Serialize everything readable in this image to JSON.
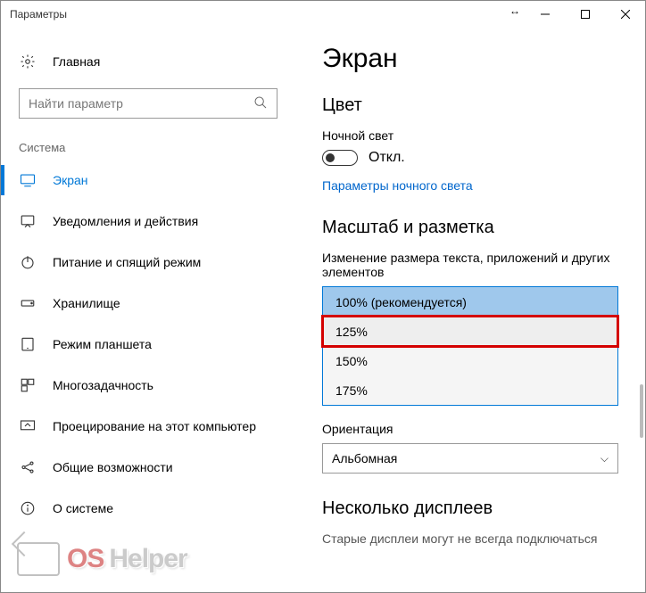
{
  "window": {
    "title": "Параметры"
  },
  "sidebar": {
    "home": "Главная",
    "search_placeholder": "Найти параметр",
    "section": "Система",
    "items": [
      {
        "label": "Экран"
      },
      {
        "label": "Уведомления и действия"
      },
      {
        "label": "Питание и спящий режим"
      },
      {
        "label": "Хранилище"
      },
      {
        "label": "Режим планшета"
      },
      {
        "label": "Многозадачность"
      },
      {
        "label": "Проецирование на этот компьютер"
      },
      {
        "label": "Общие возможности"
      },
      {
        "label": "О системе"
      }
    ]
  },
  "main": {
    "page_title": "Экран",
    "color_heading": "Цвет",
    "night_light_label": "Ночной свет",
    "night_light_state": "Откл.",
    "night_light_link": "Параметры ночного света",
    "scale_heading": "Масштаб и разметка",
    "scale_label": "Изменение размера текста, приложений и других элементов",
    "scale_options": [
      "100% (рекомендуется)",
      "125%",
      "150%",
      "175%"
    ],
    "orientation_label": "Ориентация",
    "orientation_value": "Альбомная",
    "multi_display_heading": "Несколько дисплеев",
    "truncated_text": "Старые дисплеи могут не всегда подключаться"
  },
  "watermark": {
    "part1": "OS",
    "part2": "Helper"
  }
}
